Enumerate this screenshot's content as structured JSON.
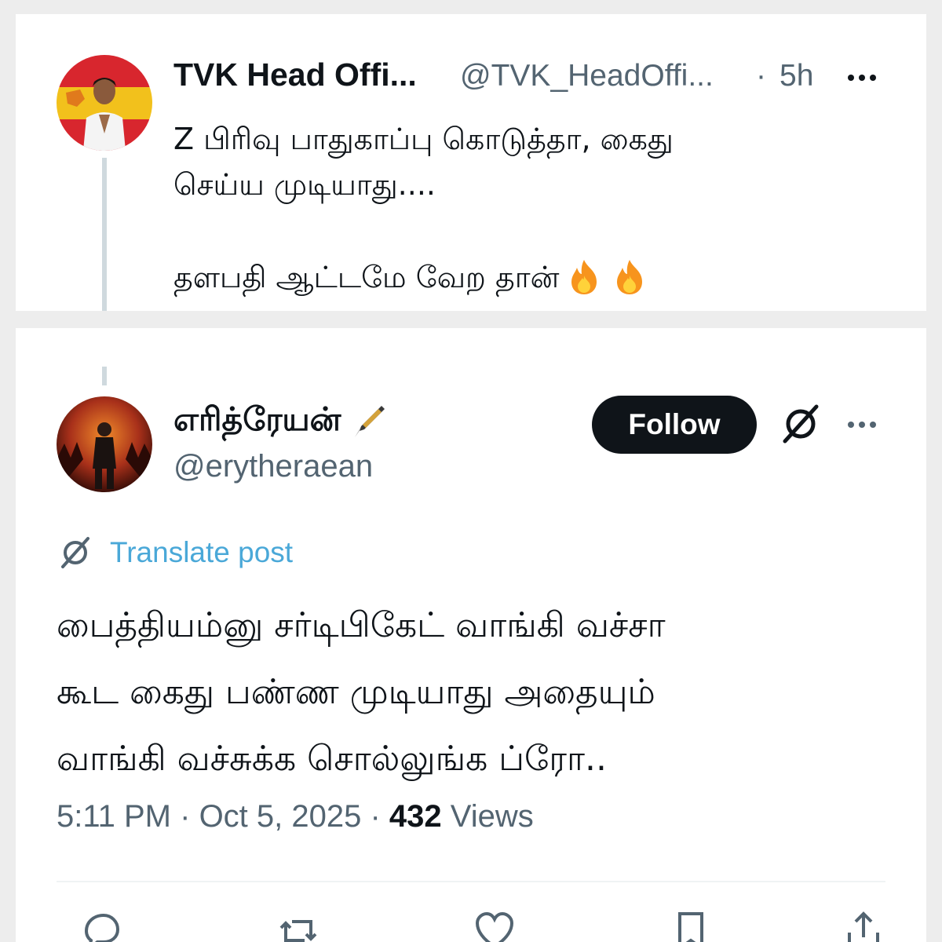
{
  "parent_tweet": {
    "display_name": "TVK Head Offi...",
    "handle": "@TVK_HeadOffi...",
    "separator": "·",
    "time_ago": "5h",
    "text_lines": [
      "Z பிரிவு பாதுகாப்பு கொடுத்தா, கைது",
      "செய்ய முடியாது...."
    ],
    "text_last_line": "தளபதி ஆட்டமே வேற தான்",
    "emoji": [
      "fire-emoji",
      "fire-emoji"
    ]
  },
  "reply_tweet": {
    "display_name": "எரித்ரேயன்",
    "name_emoji": "fountain-pen-emoji",
    "handle": "@erytheraean",
    "follow_label": "Follow",
    "translate_label": "Translate post",
    "text_lines": [
      "பைத்தியம்னு சர்டிபிகேட் வாங்கி வச்சா",
      "கூட கைது பண்ண முடியாது அதையும்",
      "வாங்கி வச்சுக்க சொல்லுங்க ப்ரோ.."
    ],
    "time": "5:11 PM",
    "date": "Oct 5, 2025",
    "views_count": "432",
    "views_label": "Views"
  },
  "colors": {
    "text_primary": "#0f1419",
    "text_secondary": "#536471",
    "link": "#4aa8d8",
    "follow_bg": "#0f1419",
    "thread_line": "#cfd9de",
    "avatar_parent_bg": [
      "#d8262e",
      "#f2c11c"
    ],
    "avatar_reply_bg": "#c4451a"
  },
  "icons": {
    "more": "more-horizontal-icon",
    "grok": "grok-icon",
    "translate": "translate-icon",
    "actions": [
      "reply-icon",
      "retweet-icon",
      "like-icon",
      "bookmark-icon",
      "share-icon"
    ]
  }
}
